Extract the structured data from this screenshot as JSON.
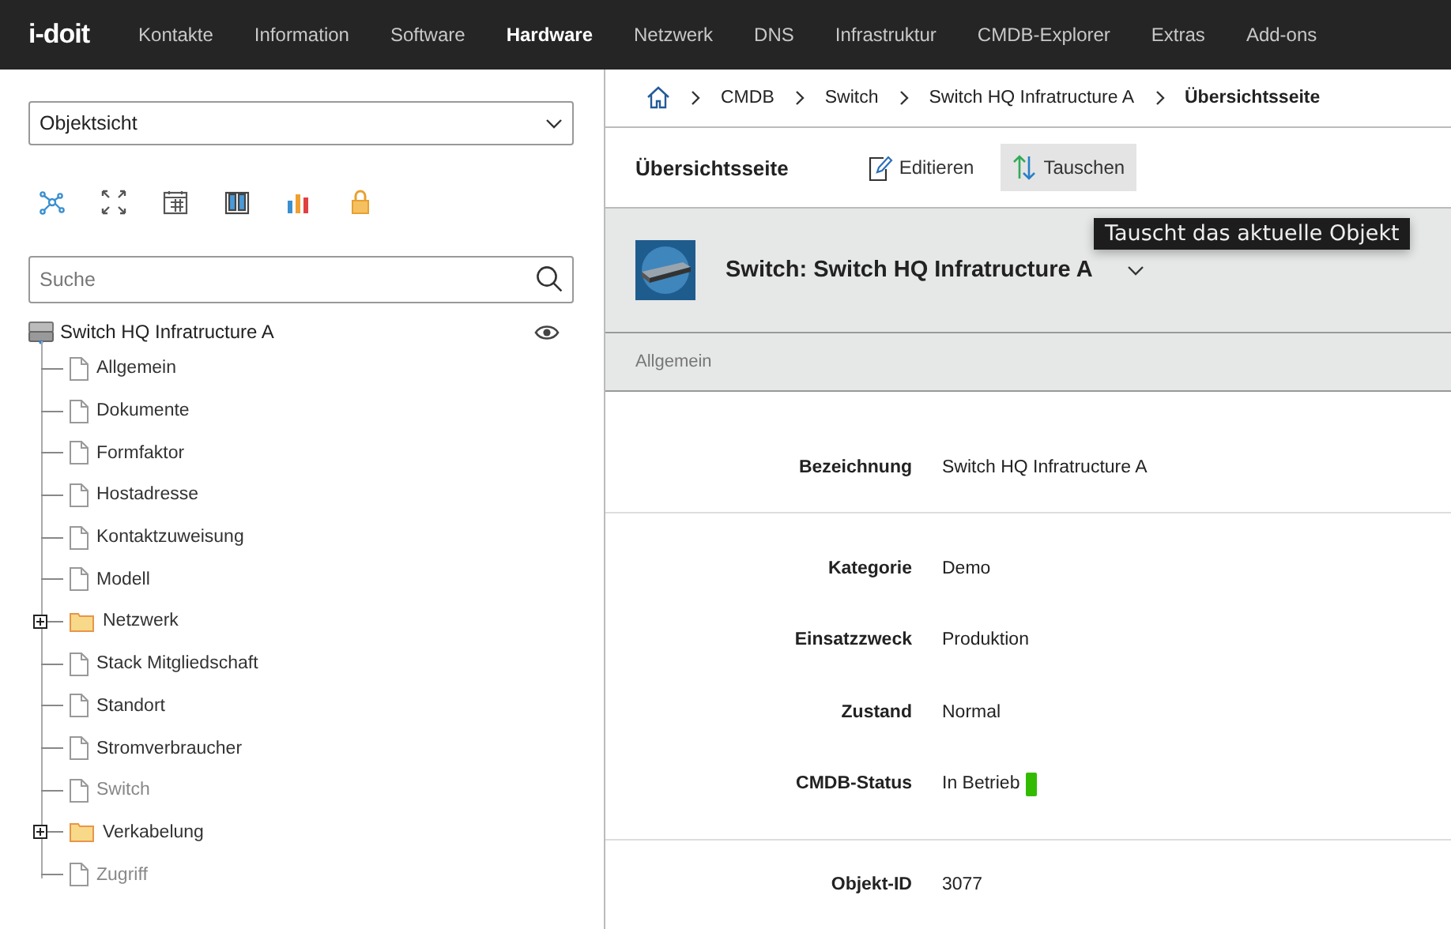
{
  "nav": {
    "logo": "i-doit",
    "items": [
      {
        "label": "Kontakte",
        "selected": false
      },
      {
        "label": "Information",
        "selected": false
      },
      {
        "label": "Software",
        "selected": false
      },
      {
        "label": "Hardware",
        "selected": true
      },
      {
        "label": "Netzwerk",
        "selected": false
      },
      {
        "label": "DNS",
        "selected": false
      },
      {
        "label": "Infrastruktur",
        "selected": false
      },
      {
        "label": "CMDB-Explorer",
        "selected": false
      },
      {
        "label": "Extras",
        "selected": false
      },
      {
        "label": "Add-ons",
        "selected": false
      }
    ]
  },
  "sidebar": {
    "view_select": {
      "value": "Objektsicht"
    },
    "search": {
      "placeholder": "Suche"
    },
    "tree": {
      "label": "Switch HQ Infratructure A",
      "children": [
        {
          "label": "Allgemein",
          "kind": "file",
          "disabled": false
        },
        {
          "label": "Dokumente",
          "kind": "file",
          "disabled": false
        },
        {
          "label": "Formfaktor",
          "kind": "file",
          "disabled": false
        },
        {
          "label": "Hostadresse",
          "kind": "file",
          "disabled": false
        },
        {
          "label": "Kontaktzuweisung",
          "kind": "file",
          "disabled": false
        },
        {
          "label": "Modell",
          "kind": "file",
          "disabled": false
        },
        {
          "label": "Netzwerk",
          "kind": "folder",
          "disabled": false,
          "expanded": false
        },
        {
          "label": "Stack Mitgliedschaft",
          "kind": "file",
          "disabled": false
        },
        {
          "label": "Standort",
          "kind": "file",
          "disabled": false
        },
        {
          "label": "Stromverbraucher",
          "kind": "file",
          "disabled": false
        },
        {
          "label": "Switch",
          "kind": "file",
          "disabled": true
        },
        {
          "label": "Verkabelung",
          "kind": "folder",
          "disabled": false,
          "expanded": false
        },
        {
          "label": "Zugriff",
          "kind": "file",
          "disabled": true
        }
      ]
    }
  },
  "breadcrumb": [
    "CMDB",
    "Switch",
    "Switch HQ Infratructure A",
    "Übersichtsseite"
  ],
  "toolbar": {
    "title": "Übersichtsseite",
    "buttons": [
      {
        "label": "Editieren",
        "kind": "edit",
        "selected": false
      },
      {
        "label": "Tauschen",
        "kind": "swap",
        "selected": true
      }
    ]
  },
  "tooltip": "Tauscht das aktuelle Objekt",
  "object": {
    "title": "Switch: Switch HQ Infratructure A",
    "category_tab": "Allgemein"
  },
  "field_groups": [
    [
      {
        "label": "Bezeichnung",
        "value": "Switch HQ Infratructure A"
      }
    ],
    [
      {
        "label": "Kategorie",
        "value": "Demo"
      },
      {
        "label": "Einsatzzweck",
        "value": "Produktion"
      },
      {
        "label": "Zustand",
        "value": "Normal"
      },
      {
        "label": "CMDB-Status",
        "value": "In Betrieb",
        "color": "#33bb00"
      }
    ],
    [
      {
        "label": "Objekt-ID",
        "value": "3077"
      }
    ]
  ]
}
